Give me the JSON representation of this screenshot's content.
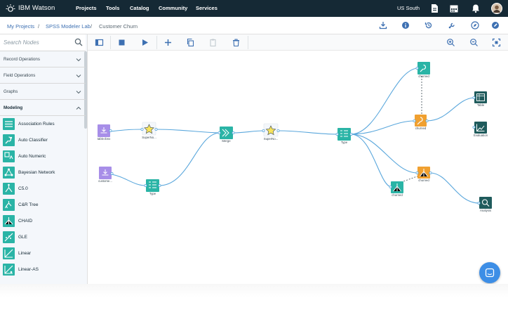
{
  "topbar": {
    "brand": "IBM Watson",
    "nav": [
      "Projects",
      "Tools",
      "Catalog",
      "Community",
      "Services"
    ],
    "region": "US South"
  },
  "breadcrumb": {
    "items": [
      "My Projects",
      "SPSS Modeler Lab",
      "Customer Churn"
    ],
    "separator": "/"
  },
  "sidebar": {
    "search_placeholder": "Search Nodes",
    "categories": [
      "Record Operations",
      "Field Operations",
      "Graphs",
      "Modeling"
    ],
    "modeling_nodes": [
      "Association Rules",
      "Auto Classifier",
      "Auto Numeric",
      "Bayesian Network",
      "C5.0",
      "C&R Tree",
      "CHAID",
      "GLE",
      "Linear",
      "Linear-AS"
    ]
  },
  "flow_nodes": {
    "tablenx": "table.tbnx",
    "supernode1": "SuperNo...",
    "customer": "custome...",
    "type1": "Type",
    "merge": "Merge",
    "supernode2": "SuperNo...",
    "type2": "Type",
    "churned_top": "churned",
    "churned_mid": "churned",
    "churned_bot": "churned",
    "churned_low": "churned",
    "table": "Table",
    "evaluation": "Evaluation",
    "analysis": "Analysis"
  },
  "colors": {
    "topbar": "#152935",
    "accent": "#3d70b2",
    "teal": "#2ab4a6",
    "purple": "#a78ee8",
    "orange": "#f0a030",
    "darkteal": "#1f5b5c",
    "link": "#5aa7dc"
  }
}
